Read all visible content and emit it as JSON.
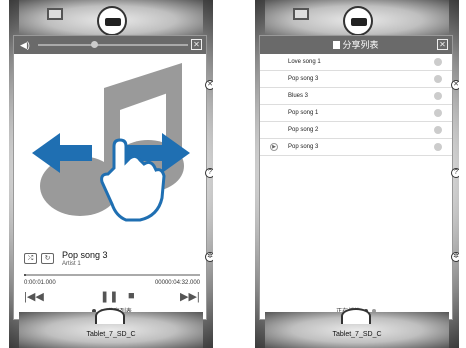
{
  "left_screen": {
    "device_label": "Tablet_7_SD_C",
    "song": {
      "title": "Pop song 3",
      "artist": "Artist 1"
    },
    "time": {
      "elapsed": "0:00:01.000",
      "total": "00000:04:32.000"
    },
    "progress_fraction": 0.01,
    "volume_fraction": 0.35,
    "page_label": "分享列表",
    "icons": [
      "volume-icon",
      "close-icon",
      "shuffle-icon",
      "repeat-icon",
      "previous-icon",
      "pause-icon",
      "stop-icon",
      "next-icon"
    ]
  },
  "right_screen": {
    "device_label": "Tablet_7_SD_C",
    "header_title": "分享列表",
    "playlist": [
      "Love song 1",
      "Pop song 3",
      "Blues 3",
      "Pop song 1",
      "Pop song 2",
      "Pop song 3"
    ],
    "now_playing_label": "正在播放"
  },
  "colors": {
    "accent_blue": "#1f6fb2",
    "header_gray": "#6a6a6a",
    "art_gray": "#9a9a9a"
  }
}
